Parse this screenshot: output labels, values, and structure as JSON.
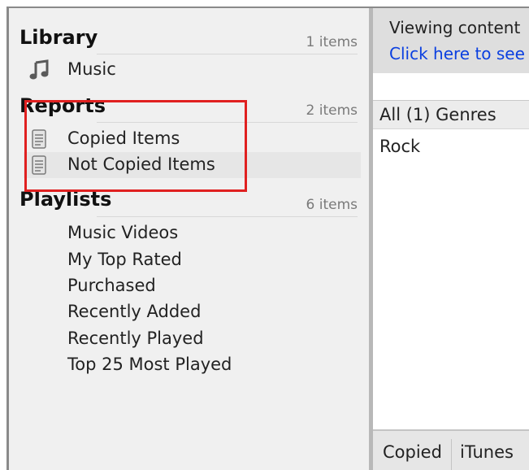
{
  "sidebar": {
    "library": {
      "title": "Library",
      "count": "1 items",
      "items": [
        {
          "label": "Music",
          "icon": "music-note-icon"
        }
      ]
    },
    "reports": {
      "title": "Reports",
      "count": "2 items",
      "items": [
        {
          "label": "Copied Items",
          "icon": "document-icon"
        },
        {
          "label": "Not Copied Items",
          "icon": "document-icon"
        }
      ]
    },
    "playlists": {
      "title": "Playlists",
      "count": "6 items",
      "items": [
        {
          "label": "Music Videos"
        },
        {
          "label": "My Top Rated"
        },
        {
          "label": "Purchased"
        },
        {
          "label": "Recently Added"
        },
        {
          "label": "Recently Played"
        },
        {
          "label": "Top 25 Most Played"
        }
      ]
    }
  },
  "main": {
    "banner": {
      "text": "Viewing content",
      "link": "Click here to see"
    },
    "genres": {
      "header": "All (1) Genres",
      "rows": [
        "Rock"
      ]
    },
    "tabs": [
      "Copied",
      "iTunes"
    ]
  },
  "colors": {
    "highlight_border": "#e02020",
    "link": "#0a3fe0",
    "sidebar_bg": "#f0f0f0"
  }
}
